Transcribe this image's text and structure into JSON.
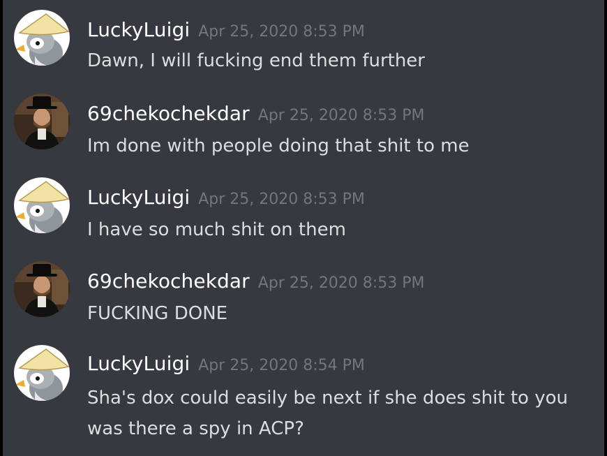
{
  "messages": [
    {
      "author": "LuckyLuigi",
      "avatar": "penguin-conical-hat-avatar",
      "timestamp": "Apr 25, 2020 8:53 PM",
      "lines": [
        "Dawn, I will fucking end them further"
      ]
    },
    {
      "author": "69chekochekdar",
      "avatar": "man-in-black-hat-avatar",
      "timestamp": "Apr 25, 2020 8:53 PM",
      "lines": [
        "Im done with people doing that shit to me"
      ]
    },
    {
      "author": "LuckyLuigi",
      "avatar": "penguin-conical-hat-avatar",
      "timestamp": "Apr 25, 2020 8:53 PM",
      "lines": [
        "I have so much shit on them"
      ]
    },
    {
      "author": "69chekochekdar",
      "avatar": "man-in-black-hat-avatar",
      "timestamp": "Apr 25, 2020 8:53 PM",
      "lines": [
        "FUCKING DONE"
      ]
    },
    {
      "author": "LuckyLuigi",
      "avatar": "penguin-conical-hat-avatar",
      "timestamp": "Apr 25, 2020 8:54 PM",
      "lines": [
        "Sha's dox could easily be next if she does shit to you",
        "was there a spy in ACP?"
      ]
    }
  ],
  "colors": {
    "background": "#36393f",
    "username": "#ffffff",
    "timestamp": "#72767d",
    "message_text": "#dcddde"
  }
}
